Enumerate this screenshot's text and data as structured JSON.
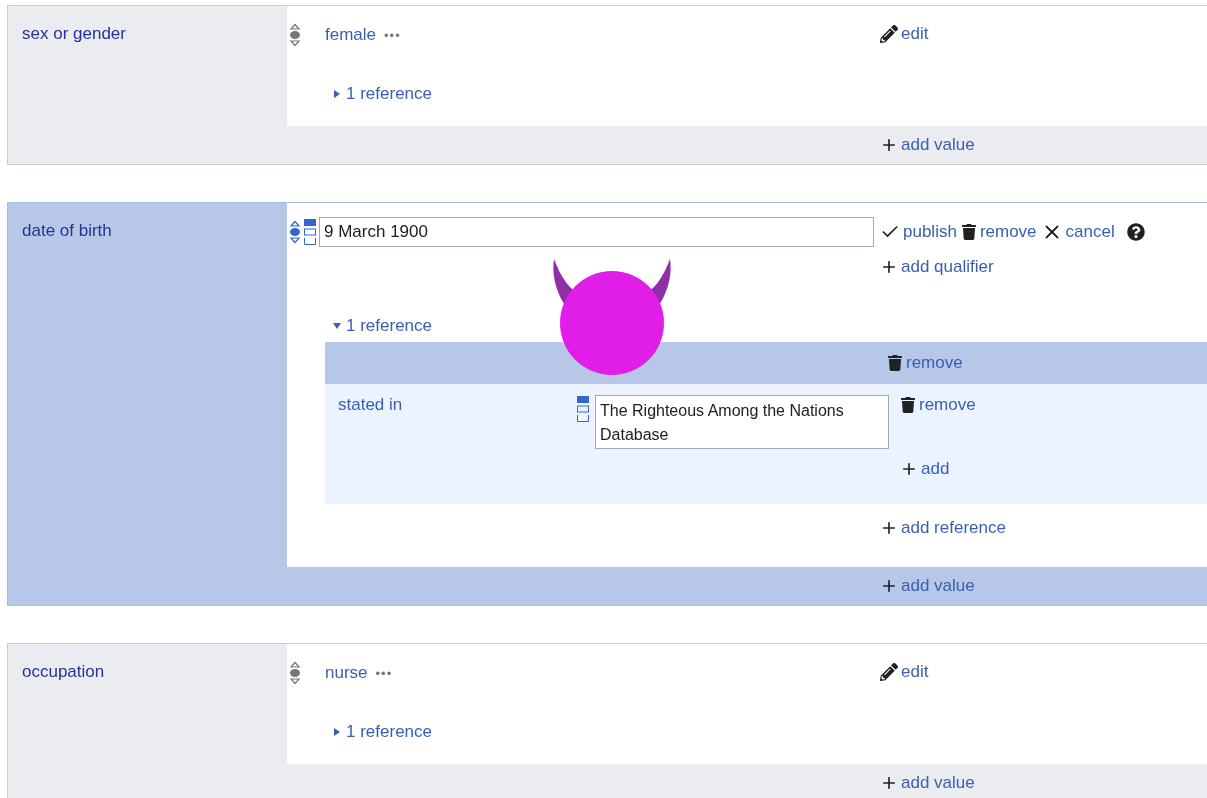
{
  "statements": [
    {
      "property": "sex or gender",
      "editing": false,
      "value": "female",
      "more": "•••",
      "action": "edit",
      "references": {
        "label": "1 reference",
        "expanded": false
      },
      "add_value": "add value"
    },
    {
      "property": "date of birth",
      "editing": true,
      "value": "9 March 1900",
      "actions": [
        {
          "kind": "publish",
          "label": "publish"
        },
        {
          "kind": "remove",
          "label": "remove"
        },
        {
          "kind": "cancel",
          "label": "cancel"
        }
      ],
      "add_qualifier": "add qualifier",
      "references": {
        "label": "1 reference",
        "expanded": true,
        "items": [
          {
            "remove": "remove",
            "snaks": [
              {
                "property": "stated in",
                "value": "The Righteous Among the Nations Database",
                "remove": "remove"
              }
            ],
            "add": "add"
          }
        ]
      },
      "add_reference": "add reference",
      "add_value": "add value"
    },
    {
      "property": "occupation",
      "editing": false,
      "value": "nurse",
      "more": "•••",
      "action": "edit",
      "references": {
        "label": "1 reference",
        "expanded": false
      },
      "add_value": "add value"
    }
  ]
}
